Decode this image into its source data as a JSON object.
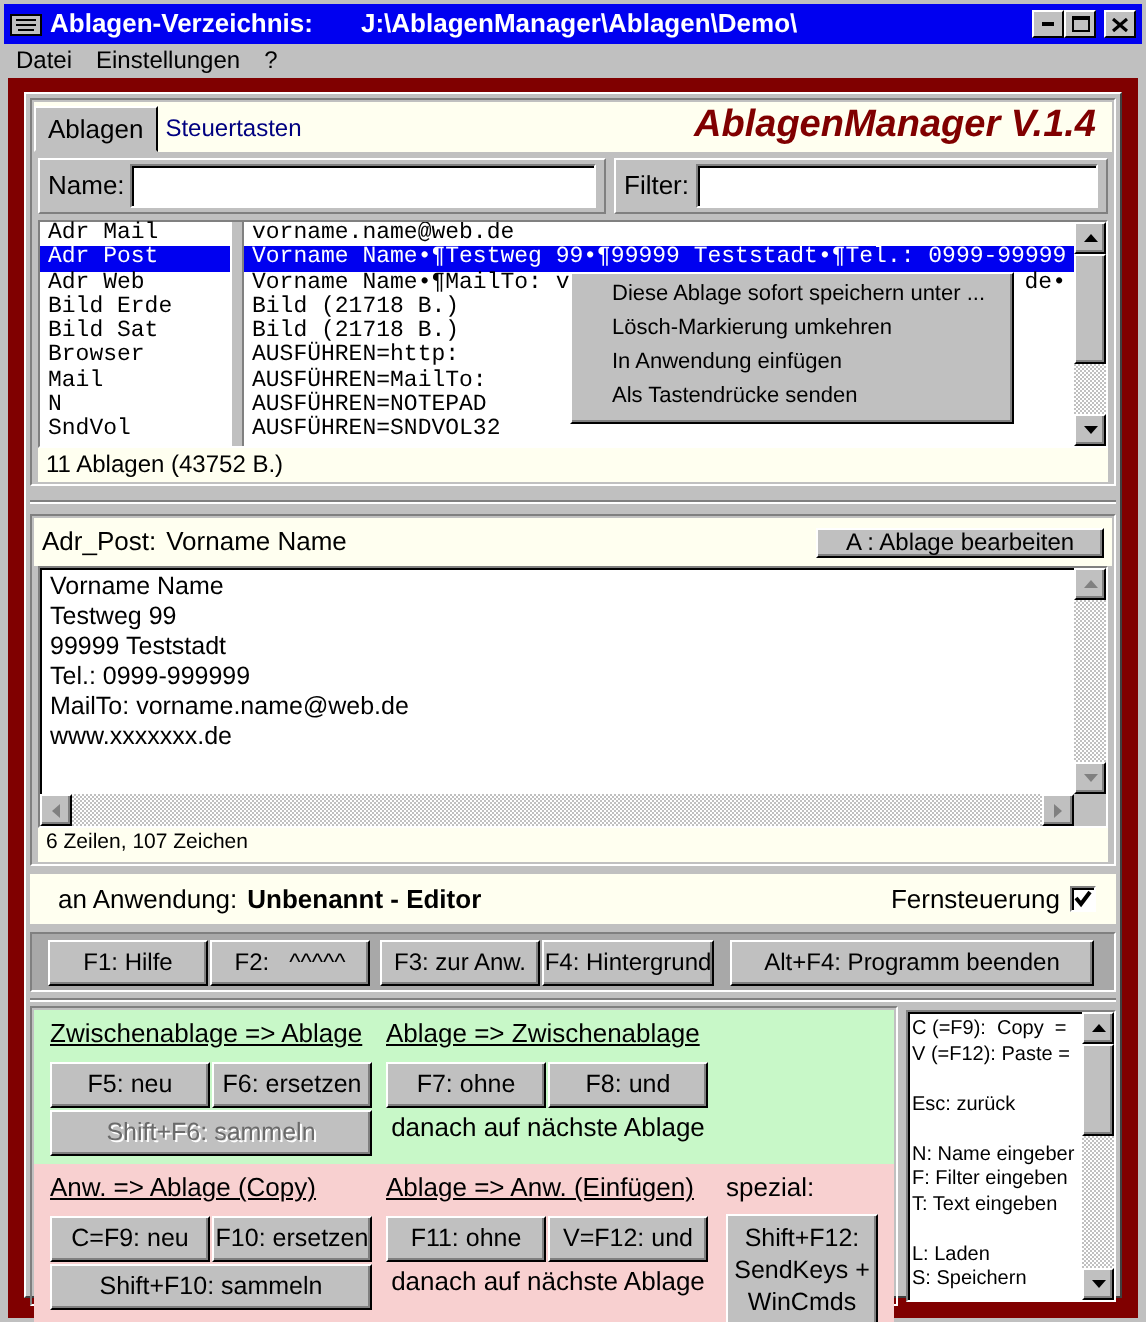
{
  "window": {
    "title": "Ablagen-Verzeichnis:",
    "path": "J:\\AblagenManager\\Ablagen\\Demo\\"
  },
  "menu": [
    "Datei",
    "Einstellungen",
    "?"
  ],
  "tabs": [
    {
      "label": "Ablagen",
      "selected": true
    },
    {
      "label": "Steuertasten",
      "selected": false
    }
  ],
  "app_title": "AblagenManager V.1.4",
  "name_field": {
    "label": "Name:"
  },
  "filter_field": {
    "label": "Filter:"
  },
  "entries": [
    {
      "name": "Adr Mail",
      "content": "vorname.name@web.de",
      "selected": false
    },
    {
      "name": "Adr Post",
      "content": "Vorname Name•¶Testweg 99•¶99999 Teststadt•¶Tel.: 0999-99999",
      "selected": true
    },
    {
      "name": "Adr Web",
      "content": "Vorname Name•¶MailTo: v",
      "content_end": "de•",
      "selected": false
    },
    {
      "name": "Bild Erde",
      "content": "Bild (21718 B.)",
      "selected": false
    },
    {
      "name": "Bild Sat",
      "content": "Bild (21718 B.)",
      "selected": false
    },
    {
      "name": "Browser",
      "content": "AUSFÜHREN=http:",
      "selected": false
    },
    {
      "name": "Mail",
      "content": "AUSFÜHREN=MailTo:",
      "selected": false
    },
    {
      "name": "N",
      "content": "AUSFÜHREN=NOTEPAD",
      "selected": false
    },
    {
      "name": "SndVol",
      "content": "AUSFÜHREN=SNDVOL32",
      "selected": false
    }
  ],
  "context_menu": [
    "Diese Ablage sofort speichern unter ...",
    "Lösch-Markierung umkehren",
    "In Anwendung einfügen",
    "Als Tastendrücke senden"
  ],
  "list_status": "11 Ablagen  (43752 B.)",
  "detail": {
    "name": "Adr_Post:",
    "title": "Vorname Name",
    "edit_button": "A : Ablage bearbeiten",
    "lines": [
      "Vorname Name",
      "Testweg 99",
      "99999 Teststadt",
      "Tel.: 0999-999999",
      "MailTo: vorname.name@web.de",
      "www.xxxxxxx.de"
    ],
    "status": "6 Zeilen, 107 Zeichen"
  },
  "target": {
    "label": "an Anwendung:",
    "app": "Unbenannt - Editor",
    "remote_label": "Fernsteuerung",
    "remote": true
  },
  "function_keys": [
    "F1: Hilfe",
    "F2:   ^^^^^",
    "F3: zur Anw.",
    "F4: Hintergrund",
    "Alt+F4: Programm beenden"
  ],
  "sections": [
    {
      "kind": "clipboard",
      "groups": [
        {
          "heading": "Zwischenablage => Ablage",
          "underlined": true,
          "buttons": [
            {
              "label": "F5: neu",
              "disabled": false
            },
            {
              "label": "F6: ersetzen",
              "disabled": false
            },
            {
              "label": "Shift+F6: sammeln",
              "disabled": true
            }
          ]
        },
        {
          "heading": "Ablage => Zwischenablage",
          "underlined": true,
          "buttons": [
            {
              "label": "F7: ohne",
              "disabled": false
            },
            {
              "label": "F8: und",
              "disabled": false
            }
          ],
          "note": "danach auf nächste Ablage"
        }
      ]
    },
    {
      "kind": "application",
      "groups": [
        {
          "heading": "Anw. => Ablage (Copy)",
          "underlined": true,
          "buttons": [
            {
              "label": "C=F9: neu",
              "disabled": false
            },
            {
              "label": "F10: ersetzen",
              "disabled": false
            },
            {
              "label": "Shift+F10: sammeln",
              "disabled": false
            }
          ]
        },
        {
          "heading": "Ablage => Anw. (Einfügen)",
          "underlined": true,
          "buttons": [
            {
              "label": "F11: ohne",
              "disabled": false
            },
            {
              "label": "V=F12: und",
              "disabled": false
            }
          ],
          "note": "danach auf nächste Ablage"
        },
        {
          "heading": "spezial:",
          "underlined": false,
          "buttons": [
            {
              "label": "Shift+F12: SendKeys + WinCmds",
              "disabled": false
            }
          ]
        }
      ]
    }
  ],
  "help": [
    [
      "C (=F9):  Copy  =",
      "V (=F12): Paste ="
    ],
    [
      "Esc: zurück"
    ],
    [
      "N: Name eingeber",
      "F: Filter eingeben",
      "T: Text eingeben"
    ],
    [
      "L: Laden",
      "S: Speichern"
    ]
  ]
}
